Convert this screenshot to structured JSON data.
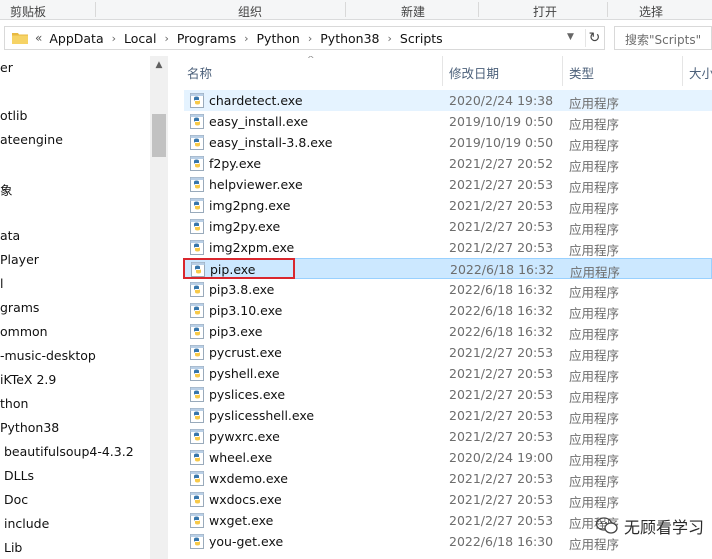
{
  "ribbon": {
    "groups": [
      "剪贴板",
      "组织",
      "新建",
      "打开",
      "选择"
    ]
  },
  "address": {
    "overflow": "«",
    "crumbs": [
      "AppData",
      "Local",
      "Programs",
      "Python",
      "Python38",
      "Scripts"
    ]
  },
  "search": {
    "placeholder": "搜索\"Scripts\""
  },
  "nav": {
    "items": [
      "er",
      "otlib",
      "ateengine",
      "象",
      "",
      "ata",
      " Player",
      "l",
      "grams",
      "ommon",
      "-music-desktop",
      "iKTeX 2.9",
      "thon",
      "Python38",
      "beautifulsoup4-4.3.2",
      "DLLs",
      "Doc",
      "include",
      "Lib"
    ]
  },
  "columns": {
    "name": "名称",
    "date": "修改日期",
    "type": "类型",
    "size": "大小"
  },
  "files": [
    {
      "name": "chardetect.exe",
      "date": "2020/2/24 19:38",
      "type": "应用程序"
    },
    {
      "name": "easy_install.exe",
      "date": "2019/10/19 0:50",
      "type": "应用程序"
    },
    {
      "name": "easy_install-3.8.exe",
      "date": "2019/10/19 0:50",
      "type": "应用程序"
    },
    {
      "name": "f2py.exe",
      "date": "2021/2/27 20:52",
      "type": "应用程序"
    },
    {
      "name": "helpviewer.exe",
      "date": "2021/2/27 20:53",
      "type": "应用程序"
    },
    {
      "name": "img2png.exe",
      "date": "2021/2/27 20:53",
      "type": "应用程序"
    },
    {
      "name": "img2py.exe",
      "date": "2021/2/27 20:53",
      "type": "应用程序"
    },
    {
      "name": "img2xpm.exe",
      "date": "2021/2/27 20:53",
      "type": "应用程序"
    },
    {
      "name": "pip.exe",
      "date": "2022/6/18 16:32",
      "type": "应用程序"
    },
    {
      "name": "pip3.8.exe",
      "date": "2022/6/18 16:32",
      "type": "应用程序"
    },
    {
      "name": "pip3.10.exe",
      "date": "2022/6/18 16:32",
      "type": "应用程序"
    },
    {
      "name": "pip3.exe",
      "date": "2022/6/18 16:32",
      "type": "应用程序"
    },
    {
      "name": "pycrust.exe",
      "date": "2021/2/27 20:53",
      "type": "应用程序"
    },
    {
      "name": "pyshell.exe",
      "date": "2021/2/27 20:53",
      "type": "应用程序"
    },
    {
      "name": "pyslices.exe",
      "date": "2021/2/27 20:53",
      "type": "应用程序"
    },
    {
      "name": "pyslicesshell.exe",
      "date": "2021/2/27 20:53",
      "type": "应用程序"
    },
    {
      "name": "pywxrc.exe",
      "date": "2021/2/27 20:53",
      "type": "应用程序"
    },
    {
      "name": "wheel.exe",
      "date": "2020/2/24 19:00",
      "type": "应用程序"
    },
    {
      "name": "wxdemo.exe",
      "date": "2021/2/27 20:53",
      "type": "应用程序"
    },
    {
      "name": "wxdocs.exe",
      "date": "2021/2/27 20:53",
      "type": "应用程序"
    },
    {
      "name": "wxget.exe",
      "date": "2021/2/27 20:53",
      "type": "应用程序"
    },
    {
      "name": "you-get.exe",
      "date": "2022/6/18 16:30",
      "type": "应用程序"
    }
  ],
  "watermark": {
    "text": "无顾看学习"
  },
  "icons": {
    "file": "python-exe-icon",
    "folder": "folder-icon",
    "refresh": "refresh-icon",
    "dropdown": "chevron-down-icon",
    "scroll_up": "scroll-up-icon"
  },
  "colors": {
    "selected_bg": "#cce8ff",
    "hover_bg": "#e5f3ff",
    "highlight_border": "#d9272e"
  }
}
